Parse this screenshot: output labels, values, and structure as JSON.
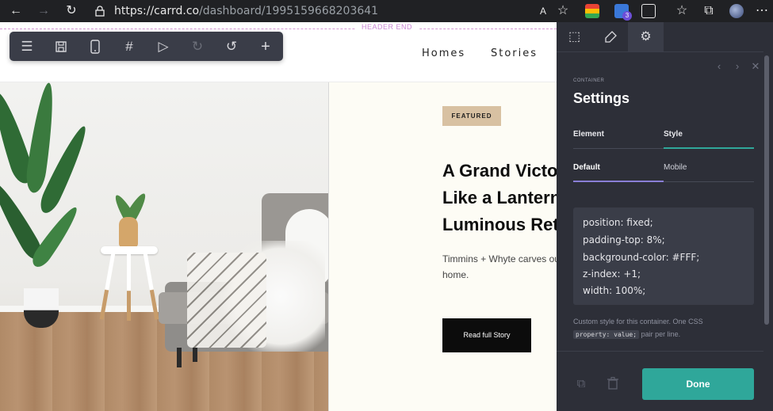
{
  "browser": {
    "back_icon": "arrow-left-icon",
    "url_domain": "https://carrd.co",
    "url_path": "/dashboard/1995159668203641",
    "extension_badge": "3"
  },
  "editor": {
    "header_end_label": "HEADER END",
    "toolbar_icons": [
      "menu-icon",
      "save-icon",
      "mobile-icon",
      "hash-icon",
      "play-icon",
      "redo-icon",
      "undo-icon",
      "plus-icon"
    ]
  },
  "site": {
    "nav": [
      "Homes",
      "Stories"
    ],
    "featured_label": "FEATURED",
    "headline": "A Grand Victorian Glows Like a Lantern After a Luminous Retrofit",
    "summary": "Timmins + Whyte carves out a light-filled Melbourne home.",
    "cta_label": "Read full Story"
  },
  "panel": {
    "section_caption": "CONTAINER",
    "title": "Settings",
    "tabs": [
      "Element",
      "Style"
    ],
    "subtabs": [
      "Default",
      "Mobile"
    ],
    "css_lines": [
      "position: fixed;",
      "padding-top: 8%;",
      "background-color: #FFF;",
      "z-index: +1;",
      "width: 100%;"
    ],
    "help_text": "Custom style for this container. One CSS",
    "help_code": "property: value;",
    "help_tail": "pair per line.",
    "done_label": "Done",
    "accent_color": "#2fa79a",
    "subtab_accent": "#8a7fd6"
  }
}
